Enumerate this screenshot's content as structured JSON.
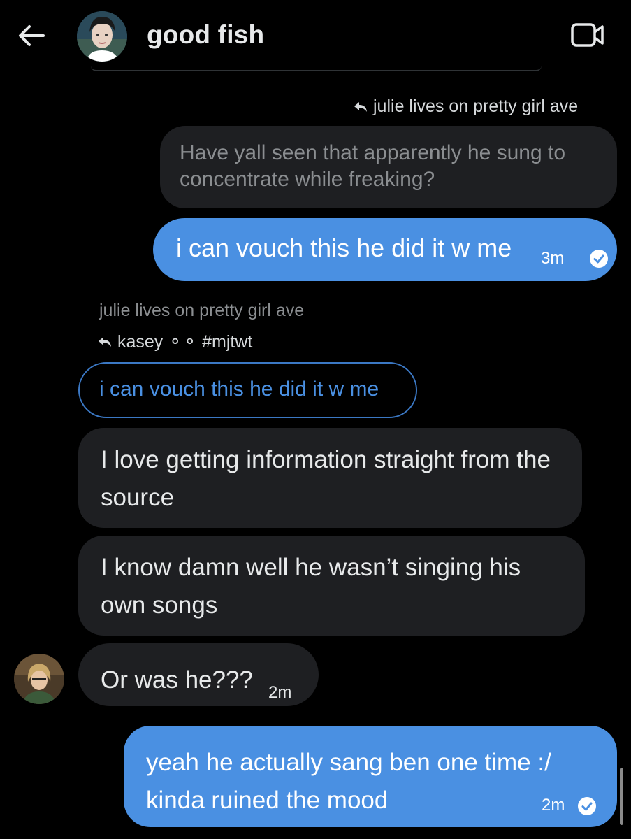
{
  "header": {
    "title": "good fish",
    "back_icon": "arrow-left-icon",
    "call_icon": "video-camera-icon"
  },
  "messages": {
    "m1": {
      "reply_to": "julie lives on pretty girl ave",
      "quoted": "Have yall seen that apparently he sung to concentrate while freaking?",
      "text": "i can vouch this he did it w me",
      "time": "3m"
    },
    "m2": {
      "sender": "julie lives on pretty girl ave",
      "reply_to": "kasey ⚬⚬ #mjtwt",
      "quoted": "i can vouch this he did it w me"
    },
    "m3": {
      "text": "I love getting information straight from the source"
    },
    "m4": {
      "text": "I know damn well he wasn’t singing his own songs"
    },
    "m5": {
      "text": "Or was he???",
      "time": "2m"
    },
    "m6": {
      "text": "yeah he actually sang ben one time :/ kinda ruined the mood",
      "time": "2m"
    }
  },
  "colors": {
    "background": "#000000",
    "sent_bubble": "#4a90e2",
    "received_bubble": "#1e1f22",
    "muted_text": "#8b8e91"
  }
}
